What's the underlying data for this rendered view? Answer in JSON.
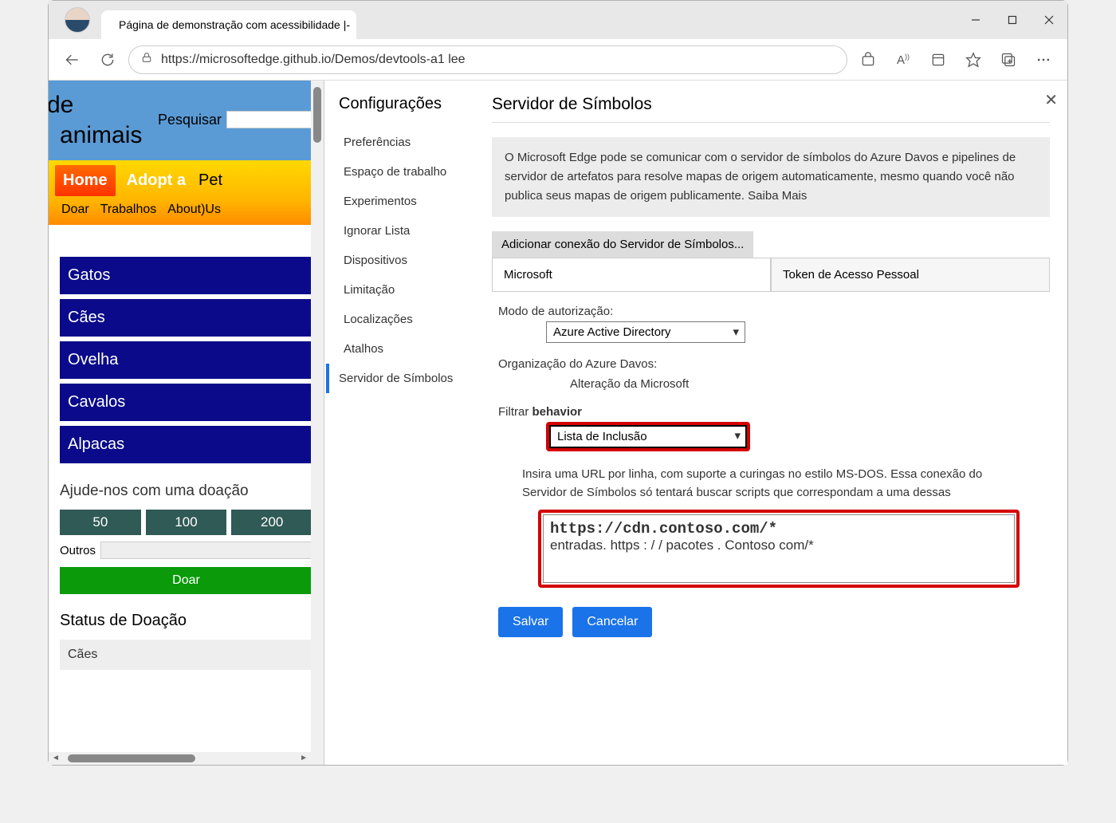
{
  "window": {
    "tab_title": "Página de demonstração com acessibilidade |-",
    "url": "https://microsoftedge.github.io/Demos/devtools-a1 lee"
  },
  "page": {
    "title_frag": "de",
    "title_animals": "animais",
    "search_label": "Pesquisar",
    "nav": {
      "home": "Home",
      "adopt": "Adopt a",
      "pet": "Pet",
      "doar": "Doar",
      "trabalhos": "Trabalhos",
      "about": "About)Us"
    },
    "pets": [
      "Gatos",
      "Cães",
      "Ovelha",
      "Cavalos",
      "Alpacas"
    ],
    "donation": {
      "title": "Ajude-nos com uma doação",
      "amounts": [
        "50",
        "100",
        "200"
      ],
      "other": "Outros",
      "submit": "Doar",
      "status_title": "Status de Doação",
      "status_row": "Cães"
    }
  },
  "devtools": {
    "settings_title": "Configurações",
    "menu": [
      "Preferências",
      "Espaço de trabalho",
      "Experimentos",
      "Ignorar Lista",
      "Dispositivos",
      "Limitação",
      "Localizações",
      "Atalhos",
      "Servidor de Símbolos"
    ],
    "heading": "Servidor de Símbolos",
    "info": "O Microsoft Edge pode se comunicar com o servidor de símbolos do Azure Davos e pipelines de servidor de artefatos para resolve mapas de origem automaticamente, mesmo quando você não publica seus mapas de origem publicamente. Saiba Mais",
    "add_connection": "Adicionar conexão do Servidor de Símbolos...",
    "tabs": {
      "microsoft": "Microsoft",
      "pat": "Token de Acesso Pessoal"
    },
    "form": {
      "auth_mode_label": "Modo de autorização:",
      "auth_mode_value": "Azure Active Directory",
      "org_label": "Organização do Azure Davos:",
      "org_value": "Alteração da Microsoft",
      "filter_label": "Filtrar",
      "filter_bold": "behavior",
      "filter_value": "Lista de Inclusão",
      "url_help": "Insira uma URL por linha, com suporte a curingas no estilo MS-DOS. Essa conexão do Servidor de Símbolos só tentará buscar scripts que correspondam a uma dessas",
      "url_value_line1": "https://cdn.contoso.com/*",
      "url_value_line2": "entradas. https : / / pacotes . Contoso com/*",
      "save": "Salvar",
      "cancel": "Cancelar"
    }
  }
}
